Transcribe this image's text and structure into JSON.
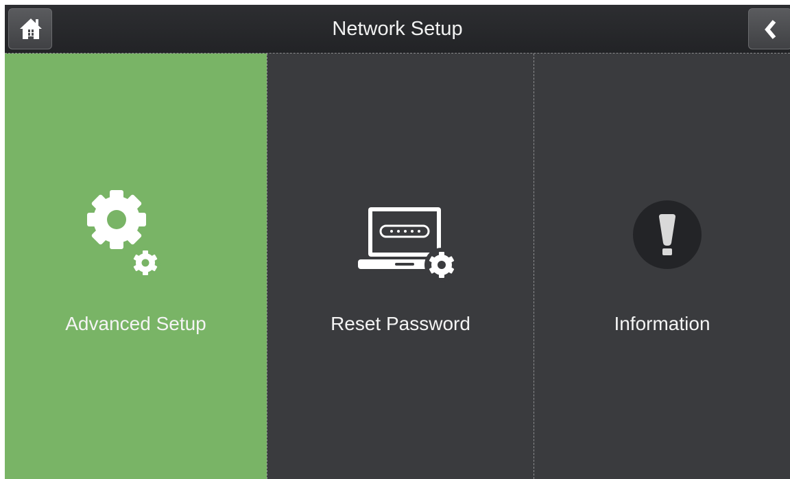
{
  "header": {
    "title": "Network Setup",
    "home_icon": "home-icon",
    "back_icon": "chevron-left-icon"
  },
  "tiles": [
    {
      "label": "Advanced Setup",
      "icon": "gears-icon",
      "selected": true
    },
    {
      "label": "Reset Password",
      "icon": "laptop-password-gear-icon",
      "selected": false
    },
    {
      "label": "Information",
      "icon": "exclamation-icon",
      "selected": false
    }
  ],
  "colors": {
    "selected_tile": "#79b466",
    "tile": "#3a3b3e",
    "header": "#2d2e31",
    "text": "#f4f4f4"
  }
}
